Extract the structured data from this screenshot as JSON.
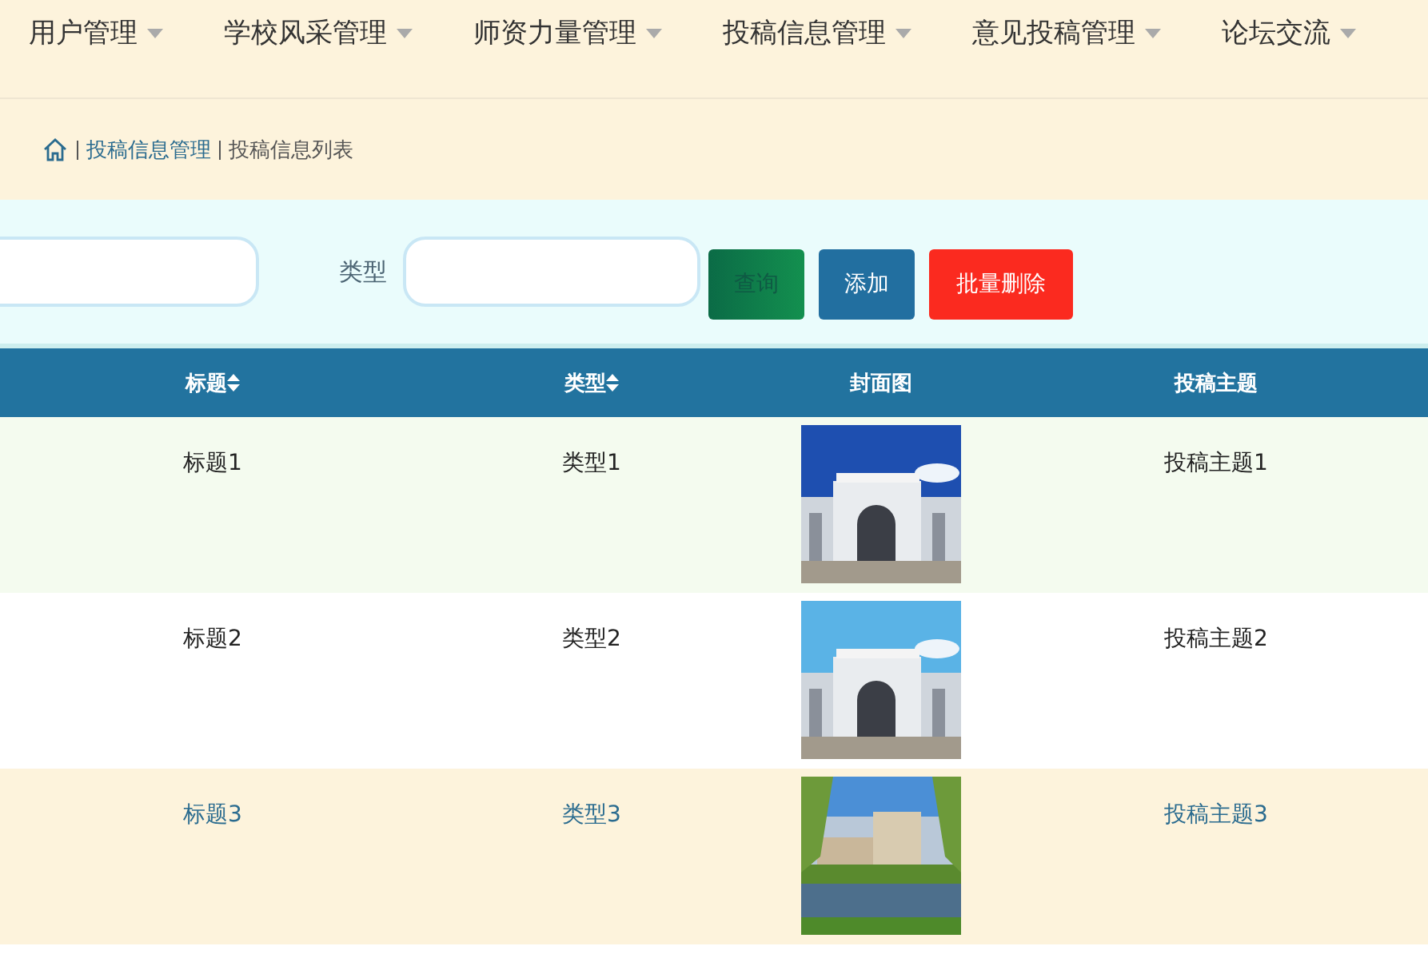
{
  "nav": [
    {
      "label": "用户管理"
    },
    {
      "label": "学校风采管理"
    },
    {
      "label": "师资力量管理"
    },
    {
      "label": "投稿信息管理"
    },
    {
      "label": "意见投稿管理"
    },
    {
      "label": "论坛交流"
    }
  ],
  "breadcrumb": [
    "投稿信息管理",
    "投稿信息列表"
  ],
  "search": {
    "fields": [
      {
        "label": "类型"
      }
    ],
    "buttons": [
      {
        "label": "查询",
        "kind": "search"
      },
      {
        "label": "添加",
        "kind": "add"
      },
      {
        "label": "批量删除",
        "kind": "delete"
      }
    ]
  },
  "table": {
    "columns": [
      {
        "label": "标题",
        "sortable": true
      },
      {
        "label": "类型",
        "sortable": true
      },
      {
        "label": "封面图",
        "sortable": false
      },
      {
        "label": "投稿主题",
        "sortable": false
      }
    ],
    "rows": [
      {
        "title": "标题1",
        "type": "类型1",
        "topic": "投稿主题1",
        "hovered": false
      },
      {
        "title": "标题2",
        "type": "类型2",
        "topic": "投稿主题2",
        "hovered": false
      },
      {
        "title": "标题3",
        "type": "类型3",
        "topic": "投稿主题3",
        "hovered": true
      }
    ]
  }
}
